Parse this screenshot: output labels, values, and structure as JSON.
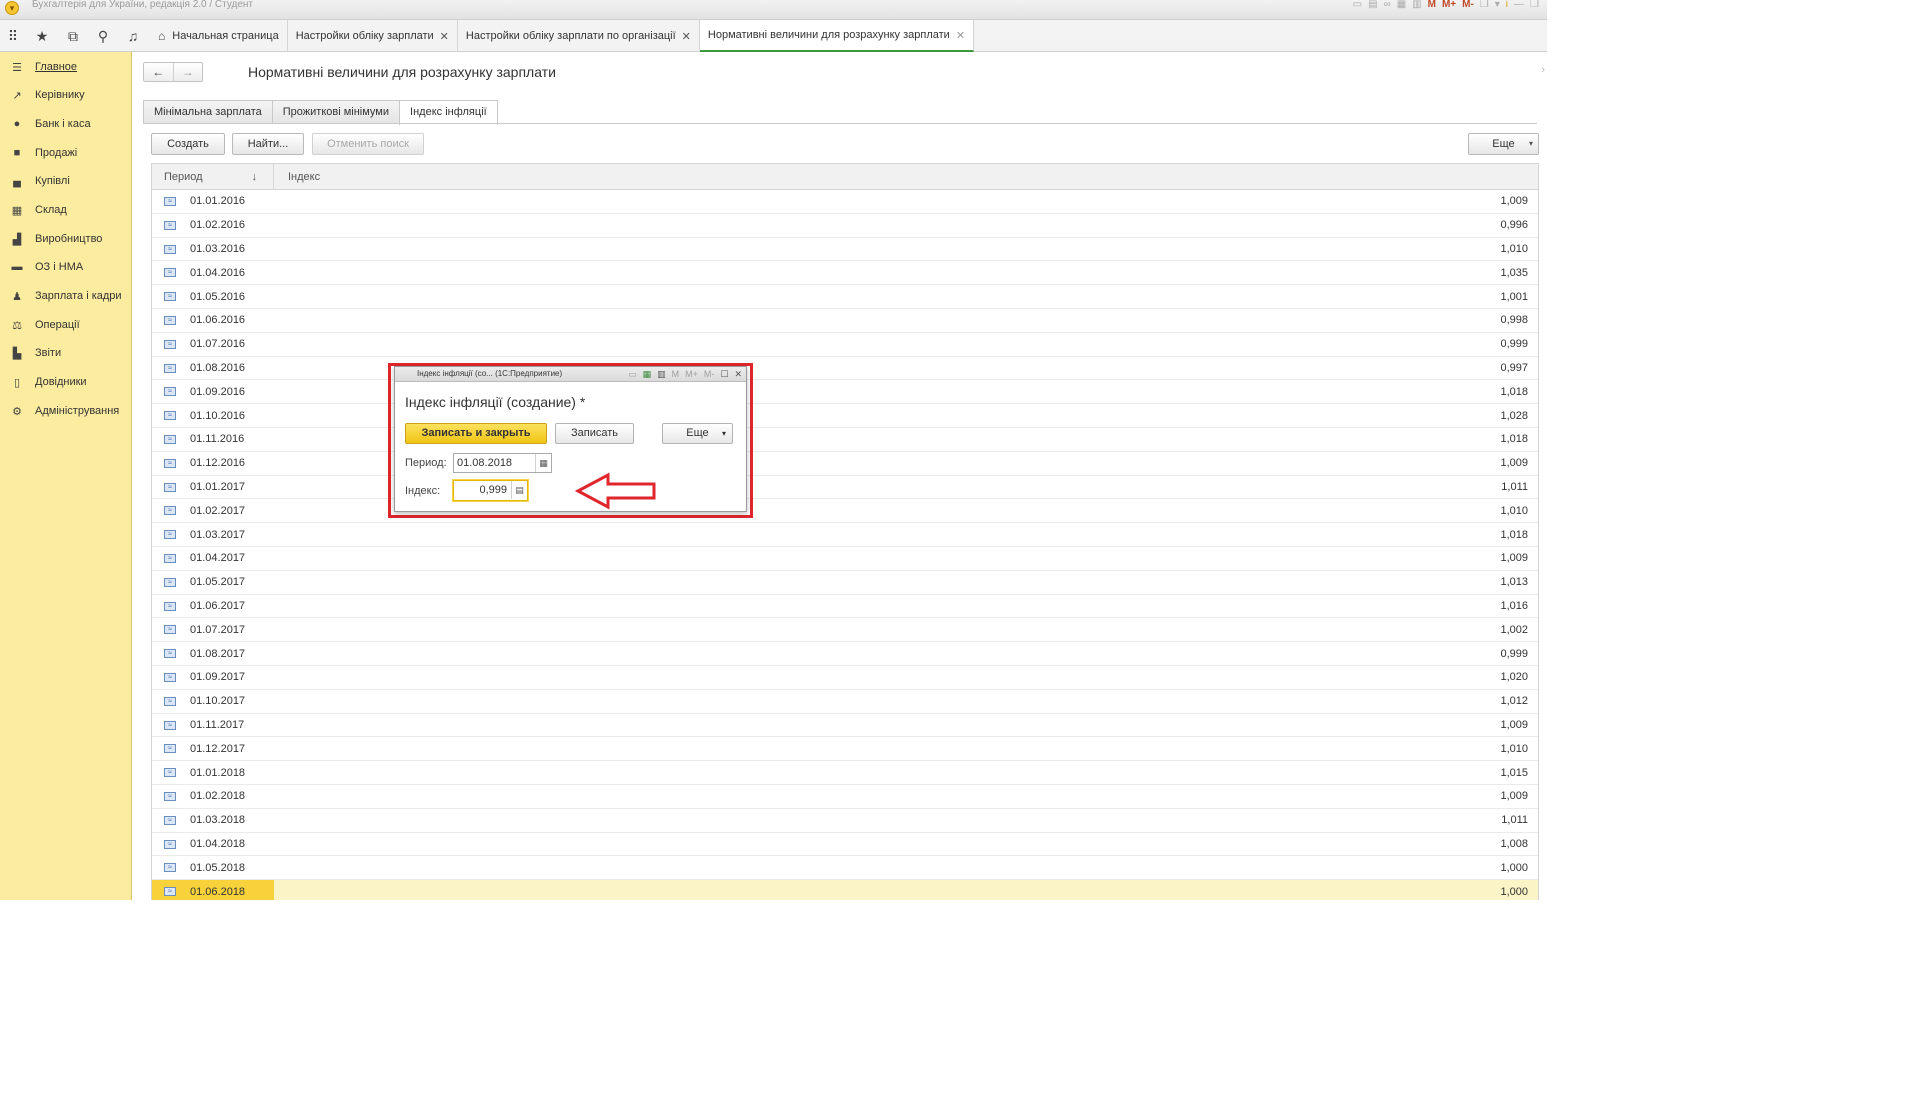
{
  "window": {
    "title": "Бухгалтерія для України, редакція 2.0 / Студент",
    "right_controls": [
      "M",
      "M+",
      "M-",
      "i"
    ]
  },
  "toolbar": {
    "icons": [
      "apps-grid-icon",
      "star-icon",
      "history-icon",
      "search-icon",
      "bell-icon"
    ]
  },
  "tabs": [
    {
      "label": "Начальная страница",
      "closable": false,
      "active": false
    },
    {
      "label": "Настройки обліку зарплати",
      "closable": true,
      "active": false
    },
    {
      "label": "Настройки обліку зарплати по організації",
      "closable": true,
      "active": false
    },
    {
      "label": "Нормативні величини для розрахунку зарплати",
      "closable": true,
      "active": true
    }
  ],
  "sidebar": {
    "items": [
      {
        "label": "Главное",
        "icon": "menu-icon",
        "current": true
      },
      {
        "label": "Керівнику",
        "icon": "trend-icon",
        "current": false
      },
      {
        "label": "Банк і каса",
        "icon": "bank-icon",
        "current": false
      },
      {
        "label": "Продажі",
        "icon": "bag-icon",
        "current": false
      },
      {
        "label": "Купівлі",
        "icon": "cart-icon",
        "current": false
      },
      {
        "label": "Склад",
        "icon": "warehouse-icon",
        "current": false
      },
      {
        "label": "Виробництво",
        "icon": "factory-icon",
        "current": false
      },
      {
        "label": "ОЗ і НМА",
        "icon": "truck-icon",
        "current": false
      },
      {
        "label": "Зарплата і кадри",
        "icon": "person-icon",
        "current": false
      },
      {
        "label": "Операції",
        "icon": "operations-icon",
        "current": false
      },
      {
        "label": "Звіти",
        "icon": "bar-chart-icon",
        "current": false
      },
      {
        "label": "Довідники",
        "icon": "book-icon",
        "current": false
      },
      {
        "label": "Адміністрування",
        "icon": "gear-icon",
        "current": false
      }
    ]
  },
  "page": {
    "title": "Нормативні величини для розрахунку зарплати",
    "subtabs": [
      "Мінімальна зарплата",
      "Прожиткові мінімуми",
      "Індекс інфляції"
    ],
    "active_subtab": 2,
    "buttons": {
      "create": "Создать",
      "find": "Найти...",
      "cancel_search": "Отменить поиск",
      "more": "Еще"
    }
  },
  "table": {
    "columns": [
      "Период",
      "Індекс"
    ],
    "rows": [
      {
        "period": "01.01.2016",
        "index": "1,009"
      },
      {
        "period": "01.02.2016",
        "index": "0,996"
      },
      {
        "period": "01.03.2016",
        "index": "1,010"
      },
      {
        "period": "01.04.2016",
        "index": "1,035"
      },
      {
        "period": "01.05.2016",
        "index": "1,001"
      },
      {
        "period": "01.06.2016",
        "index": "0,998"
      },
      {
        "period": "01.07.2016",
        "index": "0,999"
      },
      {
        "period": "01.08.2016",
        "index": "0,997"
      },
      {
        "period": "01.09.2016",
        "index": "1,018"
      },
      {
        "period": "01.10.2016",
        "index": "1,028"
      },
      {
        "period": "01.11.2016",
        "index": "1,018"
      },
      {
        "period": "01.12.2016",
        "index": "1,009"
      },
      {
        "period": "01.01.2017",
        "index": "1,011"
      },
      {
        "period": "01.02.2017",
        "index": "1,010"
      },
      {
        "period": "01.03.2017",
        "index": "1,018"
      },
      {
        "period": "01.04.2017",
        "index": "1,009"
      },
      {
        "period": "01.05.2017",
        "index": "1,013"
      },
      {
        "period": "01.06.2017",
        "index": "1,016"
      },
      {
        "period": "01.07.2017",
        "index": "1,002"
      },
      {
        "period": "01.08.2017",
        "index": "0,999"
      },
      {
        "period": "01.09.2017",
        "index": "1,020"
      },
      {
        "period": "01.10.2017",
        "index": "1,012"
      },
      {
        "period": "01.11.2017",
        "index": "1,009"
      },
      {
        "period": "01.12.2017",
        "index": "1,010"
      },
      {
        "period": "01.01.2018",
        "index": "1,015"
      },
      {
        "period": "01.02.2018",
        "index": "1,009"
      },
      {
        "period": "01.03.2018",
        "index": "1,011"
      },
      {
        "period": "01.04.2018",
        "index": "1,008"
      },
      {
        "period": "01.05.2018",
        "index": "1,000"
      },
      {
        "period": "01.06.2018",
        "index": "1,000"
      }
    ],
    "selected_row": 29
  },
  "dialog": {
    "window_title": "Індекс інфляції (со... (1С:Предприятие)",
    "heading": "Індекс інфляції (создание) *",
    "save_close_label": "Записать и закрыть",
    "save_label": "Записать",
    "more_label": "Еще",
    "period_label": "Период:",
    "period_value": "01.08.2018",
    "index_label": "Індекс:",
    "index_value": "0,999",
    "title_controls": [
      "M",
      "M+",
      "M-"
    ]
  },
  "colors": {
    "sidebar_bg": "#fbeca0",
    "primary_button": "#f5d133",
    "highlight_frame": "#e0262d",
    "active_tab_underline": "#3c9a3c",
    "selected_row": "#f7d23a"
  }
}
